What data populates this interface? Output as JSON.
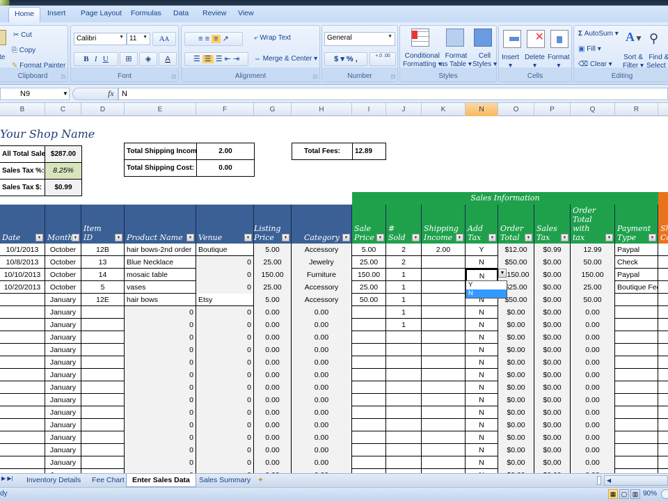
{
  "ribbon": {
    "tabs": [
      "Home",
      "Insert",
      "Page Layout",
      "Formulas",
      "Data",
      "Review",
      "View"
    ],
    "active_tab": "Home",
    "clipboard": {
      "paste": "te",
      "cut": "Cut",
      "copy": "Copy",
      "format_painter": "Format Painter",
      "label": "Clipboard"
    },
    "font": {
      "name": "Calibri",
      "size": "11",
      "bold": "B",
      "italic": "I",
      "underline": "U",
      "label": "Font"
    },
    "alignment": {
      "wrap_text": "Wrap Text",
      "merge_center": "Merge & Center",
      "label": "Alignment"
    },
    "number": {
      "format": "General",
      "currency": "$",
      "percent": "%",
      "comma": ",",
      "inc_decimal": "+.0 .00",
      "dec_decimal": ".00 +.0",
      "label": "Number"
    },
    "styles": {
      "conditional": "Conditional",
      "conditional2": "Formatting",
      "format_table": "Format",
      "format_table2": "as Table",
      "cell_styles": "Cell",
      "cell_styles2": "Styles",
      "label": "Styles"
    },
    "cells": {
      "insert": "Insert",
      "delete": "Delete",
      "format": "Format",
      "label": "Cells"
    },
    "editing": {
      "autosum": "AutoSum",
      "fill": "Fill",
      "clear": "Clear",
      "sort": "Sort &",
      "sort2": "Filter",
      "find": "Find &",
      "find2": "Select",
      "label": "Editing"
    }
  },
  "formula_bar": {
    "name_box": "N9",
    "fx": "fx",
    "value": "N"
  },
  "columns": [
    "B",
    "C",
    "D",
    "E",
    "F",
    "G",
    "H",
    "I",
    "J",
    "K",
    "N",
    "O",
    "P",
    "Q",
    "R"
  ],
  "selected_column": "N",
  "summary": {
    "shop_name": "Your Shop Name",
    "all_total_sales_label": "All Total Sales:",
    "all_total_sales": "$287.00",
    "sales_tax_pct_label": "Sales Tax %:",
    "sales_tax_pct": "8.25%",
    "sales_tax_label": "Sales Tax $:",
    "sales_tax": "$0.99",
    "total_shipping_income_label": "Total Shipping Income:",
    "total_shipping_income": "2.00",
    "total_shipping_cost_label": "Total Shipping Cost:",
    "total_shipping_cost": "0.00",
    "total_fees_label": "Total Fees:",
    "total_fees": "12.89"
  },
  "sales_info_banner": "Sales Information",
  "headers": [
    "Date",
    "Month",
    "Item ID",
    "Product Name",
    "Venue",
    "Listing Price",
    "Category",
    "Sale Price",
    "# Sold",
    "Shipping Income",
    "Add Tax",
    "Order Total",
    "Sales Tax",
    "Order Total with tax",
    "Payment Type",
    "Sh Co"
  ],
  "rows": [
    [
      "10/1/2013",
      "October",
      "12B",
      "hair bows-2nd order",
      "Boutique",
      "5.00",
      "Accessory",
      "5.00",
      "2",
      "2.00",
      "Y",
      "$12.00",
      "$0.99",
      "12.99",
      "Paypal"
    ],
    [
      "10/8/2013",
      "October",
      "13",
      "Blue Necklace",
      "0",
      "25.00",
      "Jewelry",
      "25.00",
      "2",
      "",
      "N",
      "$50.00",
      "$0.00",
      "50.00",
      "Check"
    ],
    [
      "10/10/2013",
      "October",
      "14",
      "mosaic table",
      "0",
      "150.00",
      "Furniture",
      "150.00",
      "1",
      "",
      "N",
      "$150.00",
      "$0.00",
      "150.00",
      "Paypal"
    ],
    [
      "10/20/2013",
      "October",
      "5",
      "vases",
      "0",
      "25.00",
      "Accessory",
      "25.00",
      "1",
      "",
      "Y",
      "$25.00",
      "$0.00",
      "25.00",
      "Boutique Fee"
    ],
    [
      "",
      "January",
      "12E",
      "hair bows",
      "Etsy",
      "5.00",
      "Accessory",
      "50.00",
      "1",
      "",
      "N",
      "$50.00",
      "$0.00",
      "50.00",
      ""
    ],
    [
      "",
      "January",
      "",
      "0",
      "0",
      "0.00",
      "0.00",
      "",
      "1",
      "",
      "N",
      "$0.00",
      "$0.00",
      "0.00",
      ""
    ],
    [
      "",
      "January",
      "",
      "0",
      "0",
      "0.00",
      "0.00",
      "",
      "1",
      "",
      "N",
      "$0.00",
      "$0.00",
      "0.00",
      ""
    ],
    [
      "",
      "January",
      "",
      "0",
      "0",
      "0.00",
      "0.00",
      "",
      "",
      "",
      "N",
      "$0.00",
      "$0.00",
      "0.00",
      ""
    ],
    [
      "",
      "January",
      "",
      "0",
      "0",
      "0.00",
      "0.00",
      "",
      "",
      "",
      "N",
      "$0.00",
      "$0.00",
      "0.00",
      ""
    ],
    [
      "",
      "January",
      "",
      "0",
      "0",
      "0.00",
      "0.00",
      "",
      "",
      "",
      "N",
      "$0.00",
      "$0.00",
      "0.00",
      ""
    ],
    [
      "",
      "January",
      "",
      "0",
      "0",
      "0.00",
      "0.00",
      "",
      "",
      "",
      "N",
      "$0.00",
      "$0.00",
      "0.00",
      ""
    ],
    [
      "",
      "January",
      "",
      "0",
      "0",
      "0.00",
      "0.00",
      "",
      "",
      "",
      "N",
      "$0.00",
      "$0.00",
      "0.00",
      ""
    ],
    [
      "",
      "January",
      "",
      "0",
      "0",
      "0.00",
      "0.00",
      "",
      "",
      "",
      "N",
      "$0.00",
      "$0.00",
      "0.00",
      ""
    ],
    [
      "",
      "January",
      "",
      "0",
      "0",
      "0.00",
      "0.00",
      "",
      "",
      "",
      "N",
      "$0.00",
      "$0.00",
      "0.00",
      ""
    ],
    [
      "",
      "January",
      "",
      "0",
      "0",
      "0.00",
      "0.00",
      "",
      "",
      "",
      "N",
      "$0.00",
      "$0.00",
      "0.00",
      ""
    ],
    [
      "",
      "January",
      "",
      "0",
      "0",
      "0.00",
      "0.00",
      "",
      "",
      "",
      "N",
      "$0.00",
      "$0.00",
      "0.00",
      ""
    ],
    [
      "",
      "January",
      "",
      "0",
      "0",
      "0.00",
      "0.00",
      "",
      "",
      "",
      "N",
      "$0.00",
      "$0.00",
      "0.00",
      ""
    ],
    [
      "",
      "January",
      "",
      "0",
      "0",
      "0.00",
      "0.00",
      "",
      "",
      "",
      "N",
      "$0.00",
      "$0.00",
      "0.00",
      ""
    ],
    [
      "",
      "January",
      "",
      "0",
      "0",
      "0.00",
      "0.00",
      "",
      "",
      "",
      "N",
      "$0.00",
      "$0.00",
      "0.00",
      ""
    ]
  ],
  "dropdown": {
    "options": [
      "Y",
      "N"
    ],
    "selected": "N"
  },
  "sheet_tabs": [
    "Inventory Details",
    "Fee Chart",
    "Enter Sales Data",
    "Sales Summary"
  ],
  "active_sheet": "Enter Sales Data",
  "status": {
    "left": "dy",
    "zoom": "90%"
  },
  "colors": {
    "header_blue": "#3a6096",
    "header_green": "#1fa14c",
    "header_orange": "#e8731b",
    "tax_pct_fill": "#d8e4bc"
  }
}
